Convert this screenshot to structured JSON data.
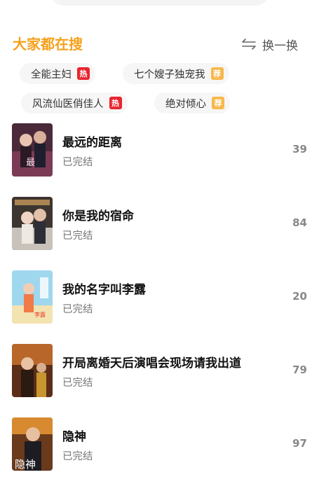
{
  "section": {
    "title": "大家都在搜",
    "refresh_label": "换一换"
  },
  "tags": [
    {
      "label": "全能主妇",
      "badge": "热"
    },
    {
      "label": "七个嫂子独宠我",
      "badge": "荐"
    },
    {
      "label": "风流仙医俏佳人",
      "badge": "热"
    },
    {
      "label": "绝对倾心",
      "badge": "荐"
    }
  ],
  "dramas": [
    {
      "title": "最远的距离",
      "status": "已完结",
      "count": "39"
    },
    {
      "title": "你是我的宿命",
      "status": "已完结",
      "count": "84"
    },
    {
      "title": "我的名字叫李露",
      "status": "已完结",
      "count": "20"
    },
    {
      "title": "开局离婚天后演唱会现场请我出道",
      "status": "已完结",
      "count": "79"
    },
    {
      "title": "隐神",
      "status": "已完结",
      "count": "97"
    }
  ],
  "colors": {
    "accent": "#f5a11c",
    "hot_badge": "#e8242f",
    "rec_badge": "#f7b84b"
  },
  "icons": {
    "refresh": "swap-arrows-icon"
  }
}
